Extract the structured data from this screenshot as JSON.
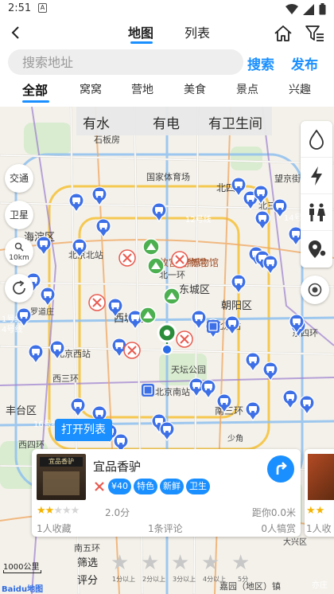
{
  "status_bar": {
    "time": "2:51",
    "notification": "A"
  },
  "nav": {
    "tabs": [
      {
        "label": "地图",
        "active": true
      },
      {
        "label": "列表",
        "active": false
      }
    ]
  },
  "search": {
    "placeholder": "搜索地址",
    "search_label": "搜索",
    "publish_label": "发布"
  },
  "categories": [
    "全部",
    "窝窝",
    "营地",
    "美食",
    "景点",
    "兴趣"
  ],
  "amenities": [
    "有水",
    "有电",
    "有卫生间"
  ],
  "map_controls": {
    "traffic": "交通",
    "satellite": "卫星",
    "scale_ctrl": "10km"
  },
  "map_labels": [
    "石板房",
    "国家体育场",
    "望京街",
    "北四环",
    "北三环",
    "12号线",
    "14号",
    "海淀区",
    "北京北站",
    "故宫博物馆",
    "府博物馆",
    "北一环",
    "东城区",
    "朝阳区",
    "西城区",
    "北京站",
    "罗道庄",
    "北京西站",
    "天坛公园",
    "北京南站",
    "东四环",
    "西三环",
    "丰台区",
    "南三环",
    "西四环",
    "16号线",
    "少角",
    "南五环",
    "亦庄",
    "1号线",
    "4号线",
    "大兴区",
    "嘉园（地区）镇"
  ],
  "open_list_label": "打开列表",
  "poi": {
    "name": "宜品香驴",
    "sign_text": "宜品香驴",
    "tags": [
      "¥40",
      "特色",
      "新鲜",
      "卫生"
    ],
    "rating": 2,
    "score": "2.0分",
    "distance": "距你0.0米",
    "collect": "1人收藏",
    "comments": "1条评论",
    "rewards": "0人犒赏"
  },
  "peek_card": {
    "collect": "1人收"
  },
  "rating_filter": {
    "label_line1": "筛选",
    "label_line2": "评分",
    "stars": [
      "1分以上",
      "2分以上",
      "3分以上",
      "4分以上",
      "5分"
    ]
  },
  "scale_text": "1000公里",
  "map_brand": "Baidu地图",
  "colors": {
    "accent": "#1a8fff",
    "marker": "#3d6fe6",
    "food": "#e85a4f",
    "camp": "#4caf50"
  }
}
